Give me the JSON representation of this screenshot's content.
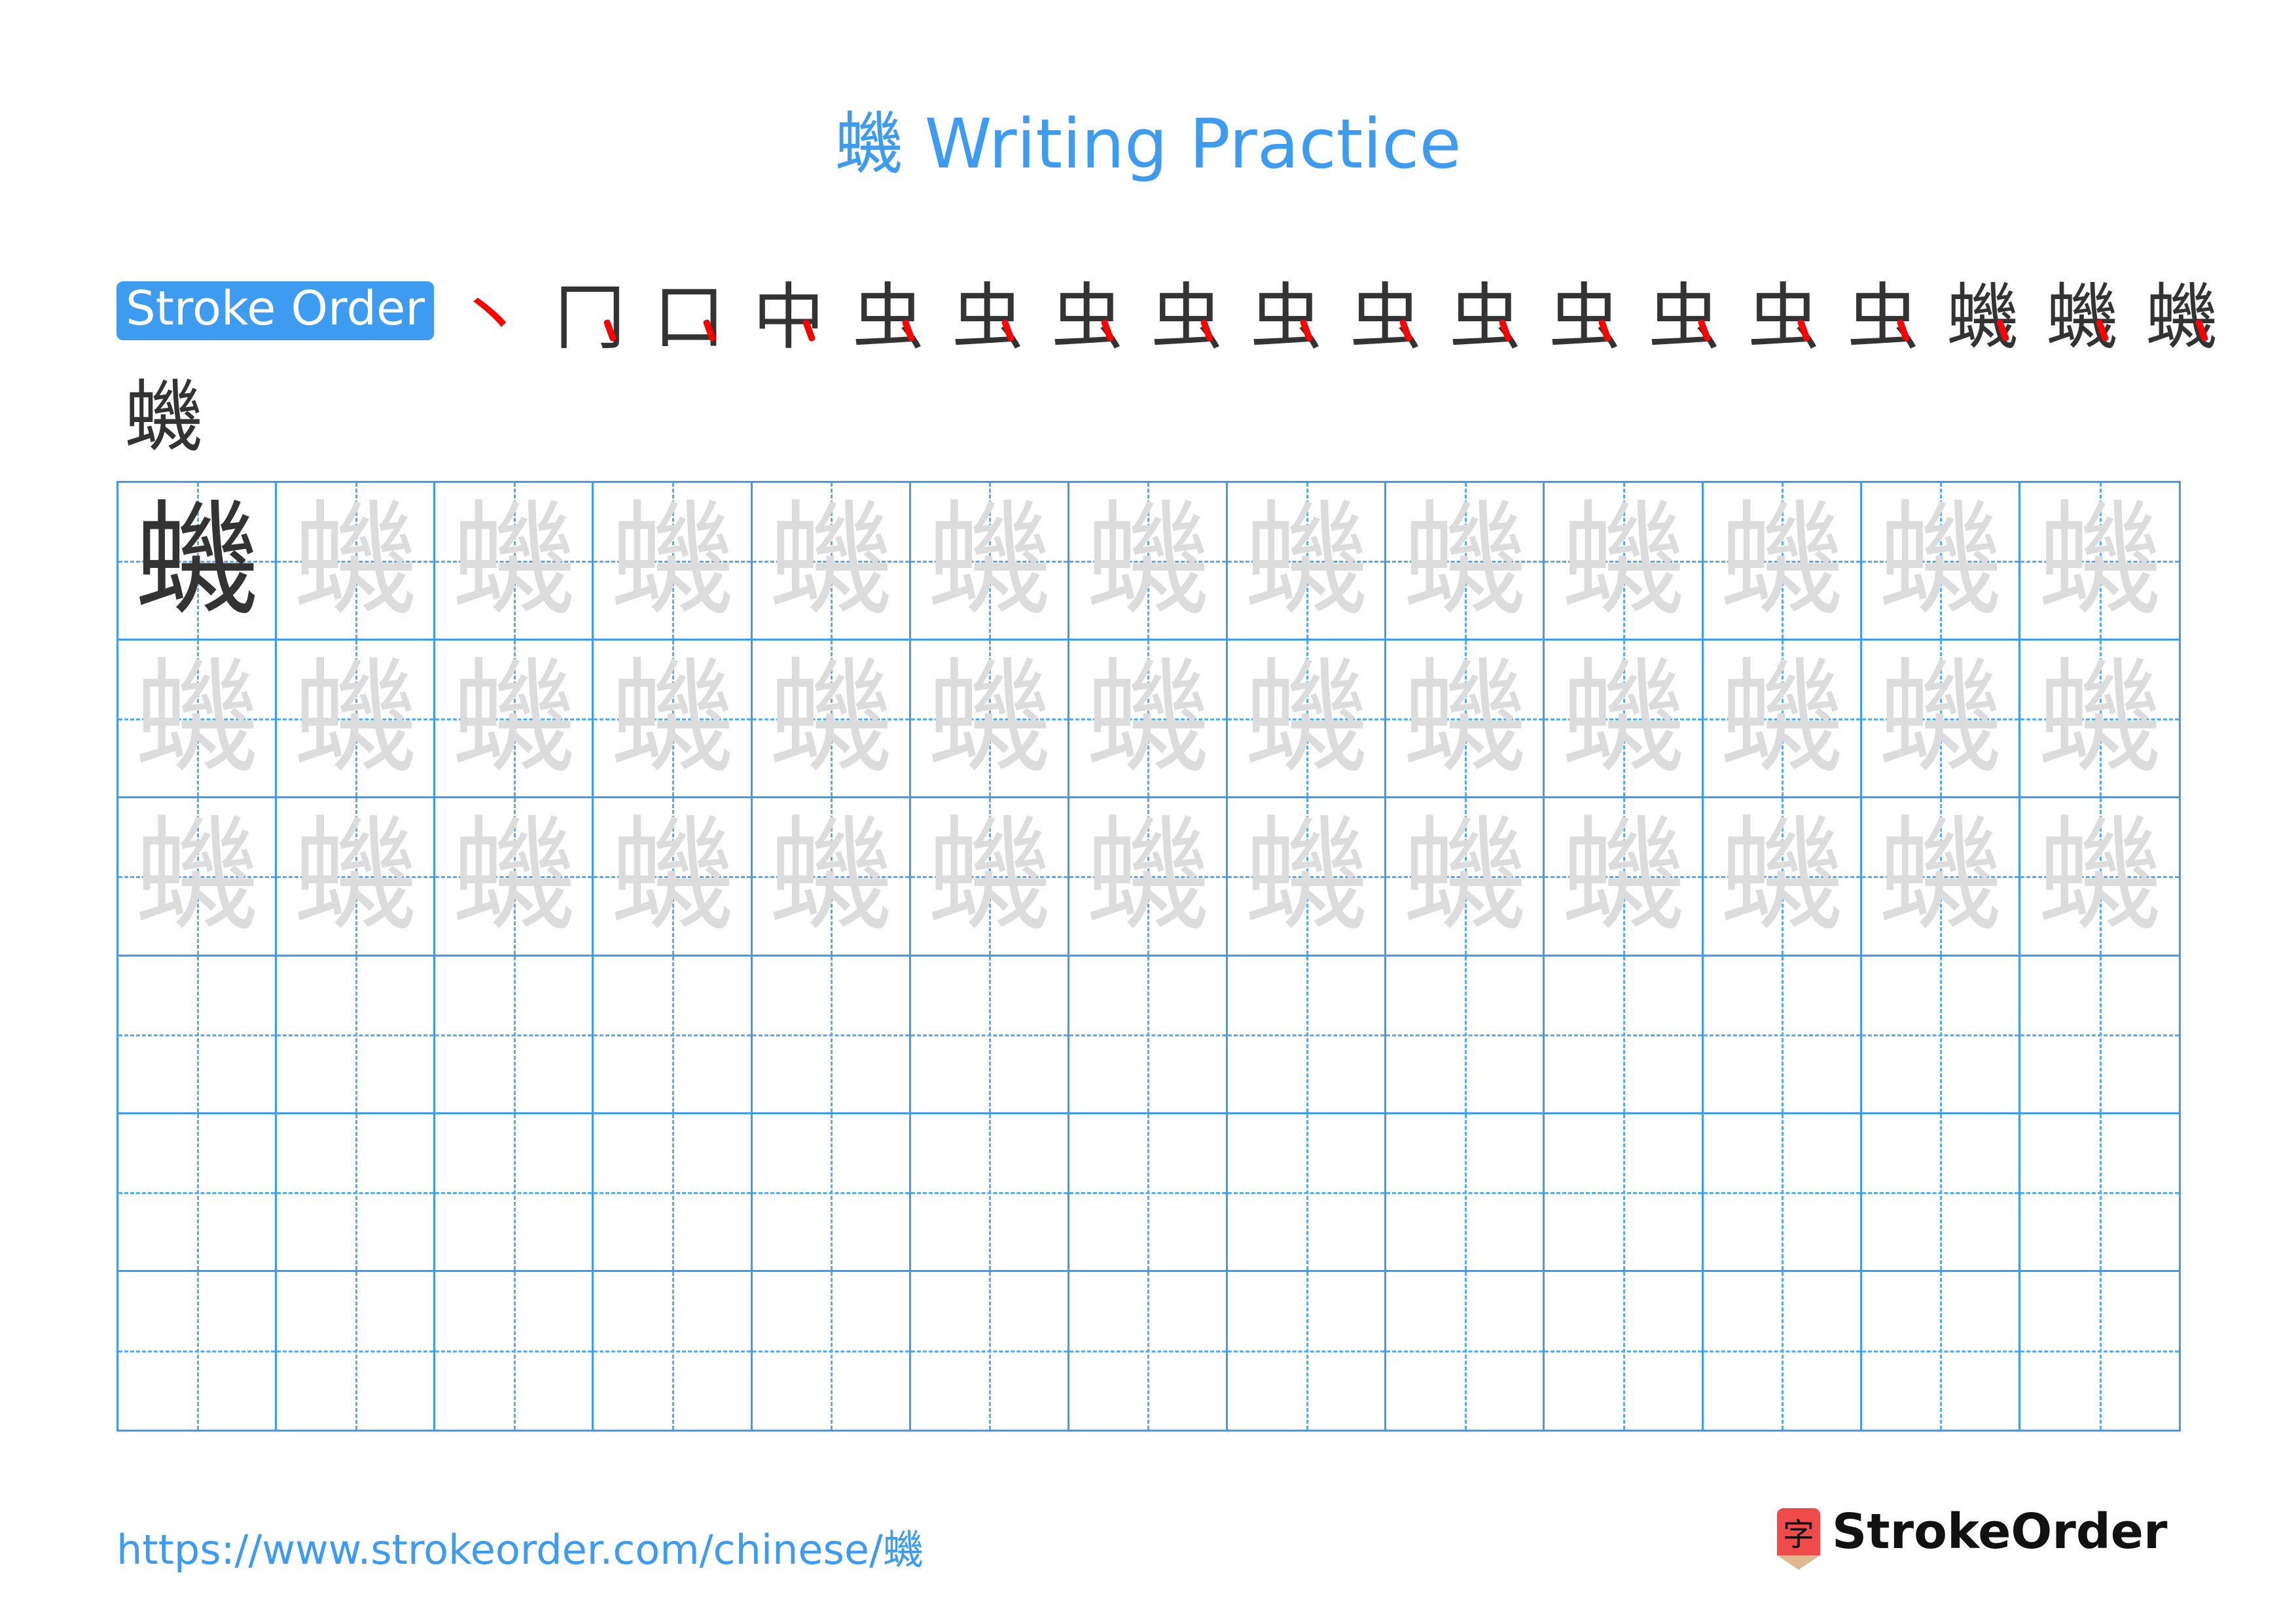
{
  "title": "蟣 Writing Practice",
  "character": "蟣",
  "stroke_order": {
    "badge_label": "Stroke Order",
    "steps": [
      "丶",
      "冂",
      "口",
      "中",
      "虫",
      "虫",
      "虫",
      "虫",
      "虫",
      "虫",
      "虫",
      "虫",
      "虫",
      "虫",
      "虫",
      "蟣",
      "蟣",
      "蟣"
    ],
    "final": "蟣",
    "highlight_color": "#ff0000"
  },
  "grid": {
    "columns": 13,
    "rows": 6,
    "model_glyph": "蟣",
    "trace_rows": 3,
    "empty_rows": 3,
    "line_color": "#3d9bf0",
    "trace_color": "#dcdcdc"
  },
  "footer": {
    "url": "https://www.strokeorder.com/chinese/蟣",
    "logo_icon_char": "字",
    "logo_text": "StrokeOrder"
  }
}
